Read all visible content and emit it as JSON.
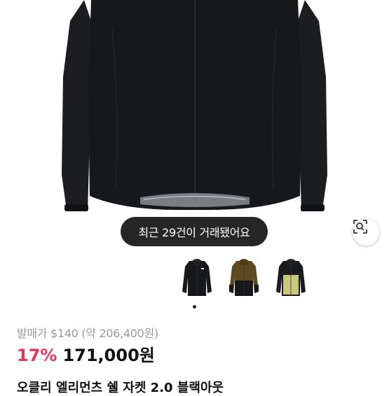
{
  "banner": {
    "recent_trades": "최근 29건이 거래됐어요"
  },
  "variants": [
    {
      "name": "black"
    },
    {
      "name": "khaki-black"
    },
    {
      "name": "lime-black"
    }
  ],
  "pricing": {
    "retail_price": "발매가 $140 (약 206,400원)",
    "discount": "17%",
    "price": "171,000원"
  },
  "product": {
    "title": "오클리 엘리먼츠 쉘 자켓 2.0 블랙아웃"
  },
  "colors": {
    "jacket": "#17181b",
    "discount": "#e6375a",
    "pill_bg": "#262626"
  },
  "icons": {
    "lens": "image-search-icon"
  }
}
